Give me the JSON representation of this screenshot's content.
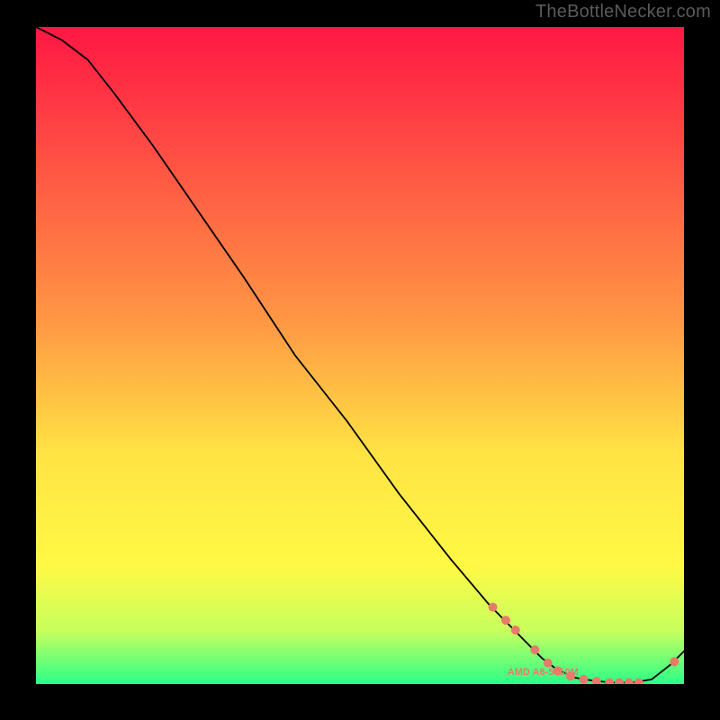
{
  "attribution": "TheBottleNecker.com",
  "chart_data": {
    "type": "line",
    "title": "",
    "xlabel": "",
    "ylabel": "",
    "xlim": [
      0,
      100
    ],
    "ylim": [
      0,
      100
    ],
    "curve": {
      "x": [
        0,
        4,
        8,
        12,
        18,
        25,
        32,
        40,
        48,
        56,
        64,
        70,
        75,
        78,
        80,
        83,
        86,
        89,
        92,
        95,
        98,
        100
      ],
      "values": [
        100,
        98,
        95,
        90,
        82,
        72,
        62,
        50,
        40,
        29,
        19,
        12,
        7,
        4,
        2.5,
        1,
        0.5,
        0.2,
        0.2,
        0.7,
        3,
        5
      ]
    },
    "markers": {
      "x": [
        70.5,
        72.5,
        74.0,
        77.0,
        79.0,
        80.5,
        82.5,
        84.5,
        86.5,
        88.5,
        90.0,
        91.5,
        93.0,
        98.5
      ],
      "values": [
        11.7,
        9.7,
        8.2,
        5.2,
        3.2,
        2.0,
        1.2,
        0.7,
        0.4,
        0.2,
        0.2,
        0.2,
        0.2,
        3.4
      ],
      "color": "#e87a6a",
      "radius": 5
    },
    "legend": {
      "label": "AMD A8-5550M",
      "x": 79,
      "y": 1.8,
      "color": "#e87a6a"
    },
    "gradient_stops": [
      {
        "offset": 0,
        "color": "#ff1744"
      },
      {
        "offset": 45,
        "color": "#ff9844"
      },
      {
        "offset": 65,
        "color": "#ffe344"
      },
      {
        "offset": 82,
        "color": "#fff944"
      },
      {
        "offset": 92,
        "color": "#c6ff5e"
      },
      {
        "offset": 100,
        "color": "#2bff88"
      }
    ]
  }
}
